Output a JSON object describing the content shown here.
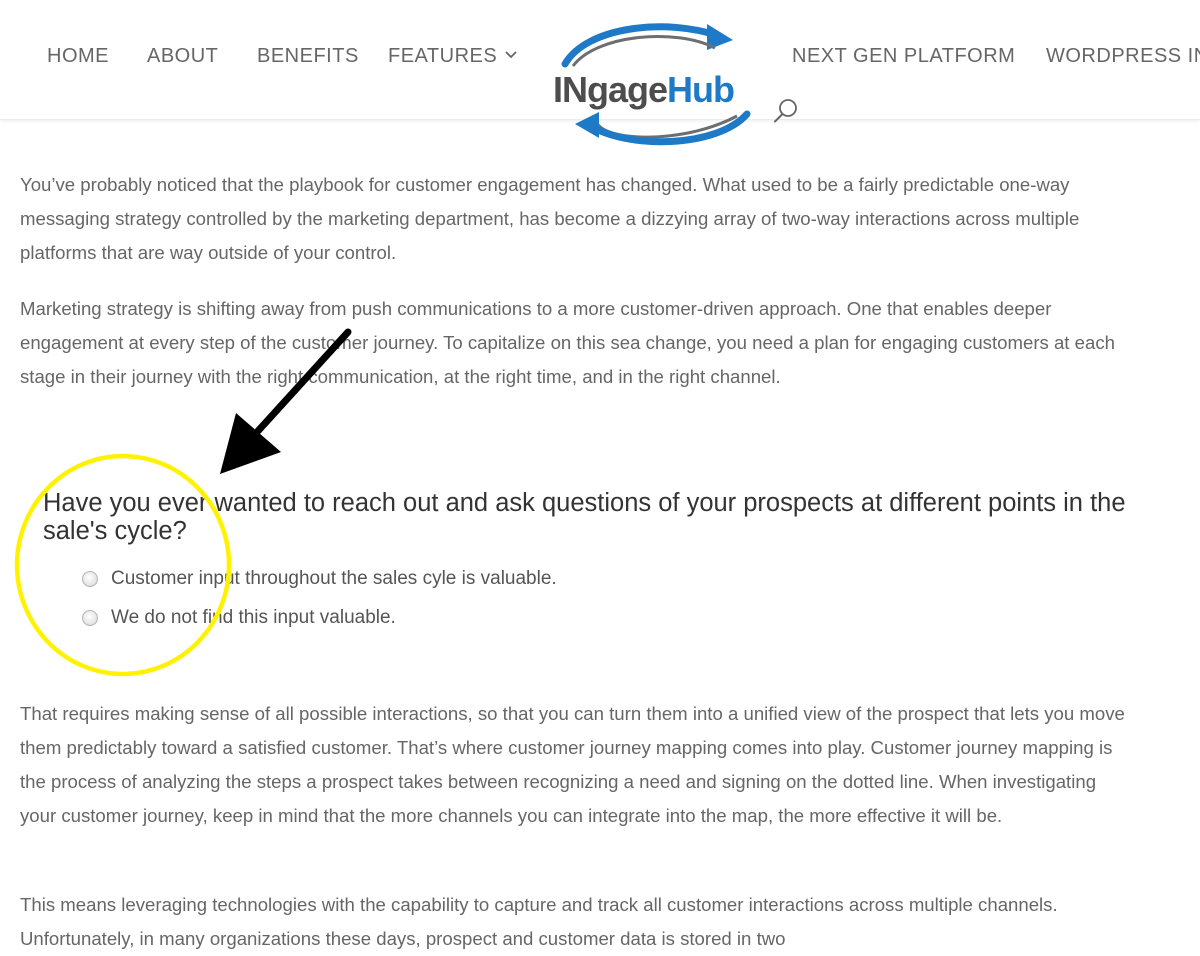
{
  "nav": {
    "items": [
      {
        "label": "HOME"
      },
      {
        "label": "ABOUT"
      },
      {
        "label": "BENEFITS"
      },
      {
        "label": "FEATURES"
      },
      {
        "label": "NEXT GEN PLATFORM"
      },
      {
        "label": "WORDPRESS INT"
      }
    ]
  },
  "logo": {
    "text_part1": "INgage",
    "text_part2": "Hub",
    "colors": {
      "dark": "#4d4d4d",
      "accent": "#1e7ac6",
      "swoosh_gray": "#6d6e71"
    }
  },
  "content": {
    "paragraph1": "You’ve probably noticed that the playbook for customer engagement has changed. What used to be a fairly predictable one-way messaging strategy controlled by the marketing department, has become a dizzying array of two-way interactions across multiple platforms that are way outside of your control.",
    "paragraph2": "Marketing strategy is shifting away from push communications to a more customer-driven approach. One that enables deeper engagement at every step of the customer journey. To capitalize on this sea change, you need a plan for engaging customers at each stage in their journey with the right communication, at the right time, and in the right channel.",
    "poll": {
      "question": "Have you ever wanted to reach out and ask questions of your prospects at different points in the sale's cycle?",
      "options": [
        {
          "label": "Customer input throughout the sales cyle is valuable.",
          "selected": false
        },
        {
          "label": "We do not find this input valuable.",
          "selected": false
        }
      ]
    },
    "paragraph3": "That requires making sense of all possible interactions, so that you can turn them into a unified view of the prospect that lets you move them predictably toward a satisfied customer. That’s where customer journey mapping comes into play. Customer journey mapping is the process of analyzing the steps a prospect takes between recognizing a need and signing on the dotted line. When investigating your customer journey, keep in mind that the more channels you can integrate into the map, the more effective it will be.",
    "paragraph4": "This means leveraging technologies with the capability to capture and track all customer interactions across multiple channels. Unfortunately, in many organizations these days, prospect and customer data is stored in two"
  },
  "annotation": {
    "circle_color": "#fff200",
    "arrow_color": "#000000"
  }
}
